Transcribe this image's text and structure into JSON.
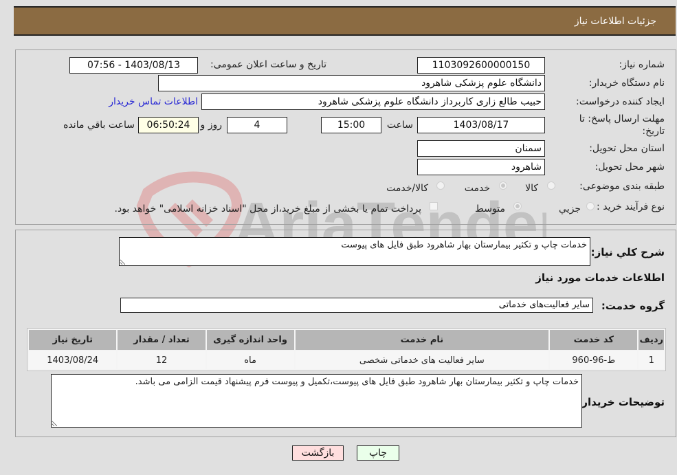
{
  "header": {
    "title": "جزئیات اطلاعات نیاز"
  },
  "form": {
    "need_number": {
      "label": "شماره نیاز:",
      "value": "1103092600000150"
    },
    "announce": {
      "label": "تاریخ و ساعت اعلان عمومی:",
      "value": "1403/08/13 - 07:56"
    },
    "buyer_org": {
      "label": "نام دستگاه خریدار:",
      "value": "دانشگاه علوم پزشکی شاهرود"
    },
    "creator": {
      "label": "ایجاد کننده درخواست:",
      "value": "حبیب طالع زاری کاربرداز دانشگاه علوم پزشکی شاهرود",
      "contact_link": "اطلاعات تماس خریدار"
    },
    "deadline": {
      "label": "مهلت ارسال پاسخ: تا تاریخ:",
      "date": "1403/08/17",
      "time_label": "ساعت",
      "time": "15:00",
      "days": "4",
      "days_label": "روز و",
      "remaining": "06:50:24",
      "remaining_label": "ساعت باقي مانده"
    },
    "province": {
      "label": "استان محل تحویل:",
      "value": "سمنان"
    },
    "city": {
      "label": "شهر محل تحویل:",
      "value": "شاهرود"
    },
    "category": {
      "label": "طبقه بندی موضوعی:",
      "options": [
        {
          "label": "کالا",
          "selected": false
        },
        {
          "label": "خدمت",
          "selected": true
        },
        {
          "label": "کالا/خدمت",
          "selected": false
        }
      ]
    },
    "purchase_type": {
      "label": "نوع فرآیند خرید :",
      "options": [
        {
          "label": "جزيي",
          "selected": false
        },
        {
          "label": "متوسط",
          "selected": true
        }
      ],
      "treasury_note": "پرداخت تمام یا بخشی از مبلغ خرید،از محل \"اسناد خزانه اسلامی\" خواهد بود.",
      "treasury_checked": false
    }
  },
  "description": {
    "label": "شرح کلي نیاز:",
    "value": "خدمات چاپ و تکثیر بیمارستان بهار شاهرود طبق فایل های پیوست"
  },
  "services_section": {
    "title": "اطلاعات خدمات مورد نیاز",
    "group_label": "گروه خدمت:",
    "group_value": "سایر فعالیت‌های خدماتی",
    "table": {
      "headers": [
        "ردیف",
        "کد خدمت",
        "نام خدمت",
        "واحد اندازه گیری",
        "تعداد / مقدار",
        "تاریخ نیاز"
      ],
      "rows": [
        [
          "1",
          "ط-96-960",
          "سایر فعالیت های خدماتی شخصی",
          "ماه",
          "12",
          "1403/08/24"
        ]
      ]
    },
    "buyer_notes_label": "توضیحات خریدار:",
    "buyer_notes": "خدمات چاپ و تکثیر بیمارستان بهار شاهرود طبق فایل های پیوست،تکمیل و پیوست فرم پیشنهاد قیمت الزامی می باشد."
  },
  "buttons": {
    "print": "چاپ",
    "back": "بازگشت"
  },
  "colors": {
    "header_bg": "#8b6b42",
    "print_bg": "#eaffea",
    "back_bg": "#ffdede",
    "link": "#2a2ad4"
  },
  "watermark": {
    "text": "AriaTender.neT"
  }
}
